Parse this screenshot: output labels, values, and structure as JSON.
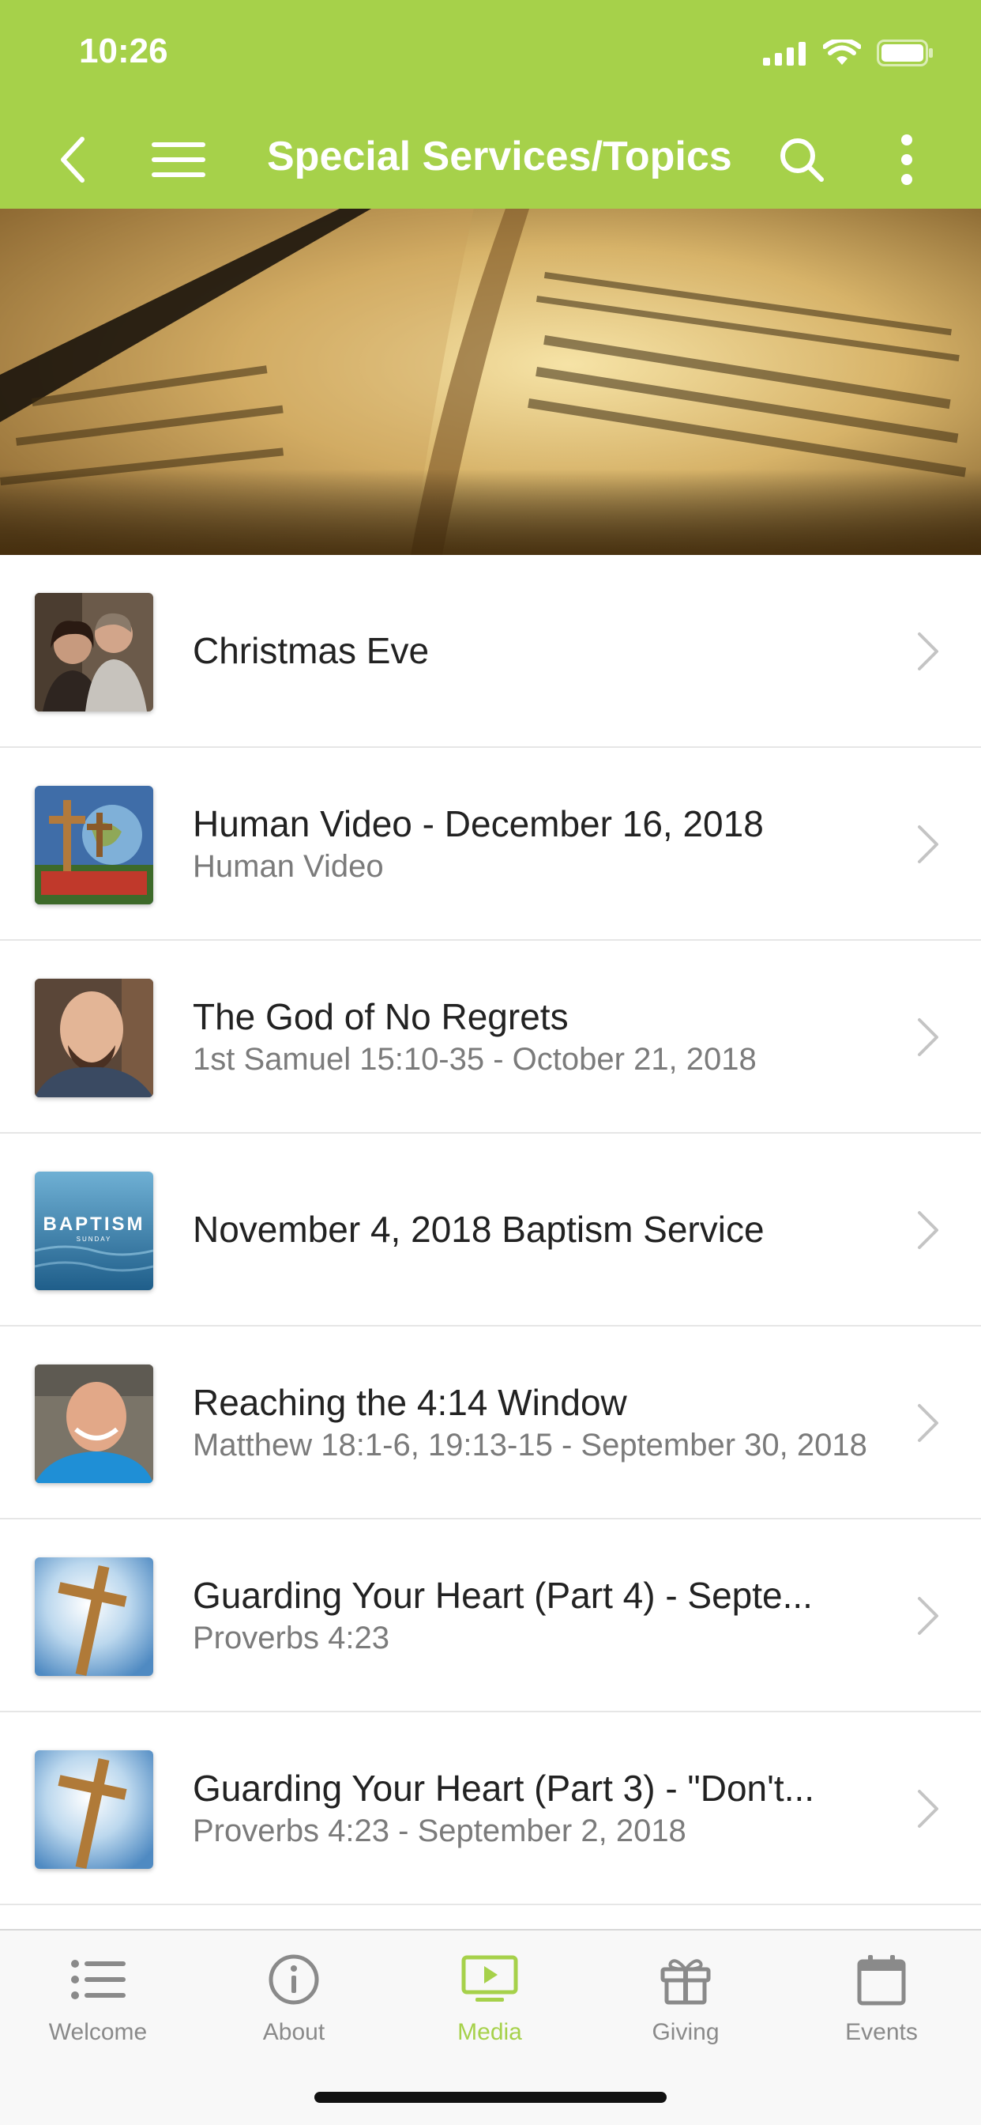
{
  "status": {
    "time": "10:26"
  },
  "header": {
    "title": "Special Services/Topics"
  },
  "items": [
    {
      "title": "Christmas Eve",
      "subtitle": "",
      "thumb": "couple-photo"
    },
    {
      "title": "Human Video -  December 16, 2018",
      "subtitle": "Human Video",
      "thumb": "cross-globe-photo"
    },
    {
      "title": "The God of No Regrets",
      "subtitle": "1st Samuel 15:10-35 - October 21, 2018",
      "thumb": "bald-man-photo"
    },
    {
      "title": "November 4, 2018 Baptism Service",
      "subtitle": "",
      "thumb": "baptism-graphic",
      "thumb_text": "BAPTISM",
      "thumb_subtext": "SUNDAY"
    },
    {
      "title": "Reaching the 4:14 Window",
      "subtitle": "Matthew 18:1-6, 19:13-15 - September 30, 2018",
      "thumb": "smiling-man-photo"
    },
    {
      "title": "Guarding Your Heart (Part 4) - Septe...",
      "subtitle": "Proverbs 4:23",
      "thumb": "cross-sky-photo"
    },
    {
      "title": "Guarding Your Heart (Part 3) - \"Don't...",
      "subtitle": "Proverbs 4:23 - September 2, 2018",
      "thumb": "cross-sky-photo"
    }
  ],
  "tabs": [
    {
      "label": "Welcome",
      "icon": "list-icon",
      "active": false
    },
    {
      "label": "About",
      "icon": "info-icon",
      "active": false
    },
    {
      "label": "Media",
      "icon": "tv-play-icon",
      "active": true
    },
    {
      "label": "Giving",
      "icon": "gift-icon",
      "active": false
    },
    {
      "label": "Events",
      "icon": "calendar-icon",
      "active": false
    }
  ],
  "colors": {
    "accent": "#a6d14a",
    "inactive": "#8a8a8a",
    "text": "#222222",
    "subtext": "#7b7b7b"
  }
}
